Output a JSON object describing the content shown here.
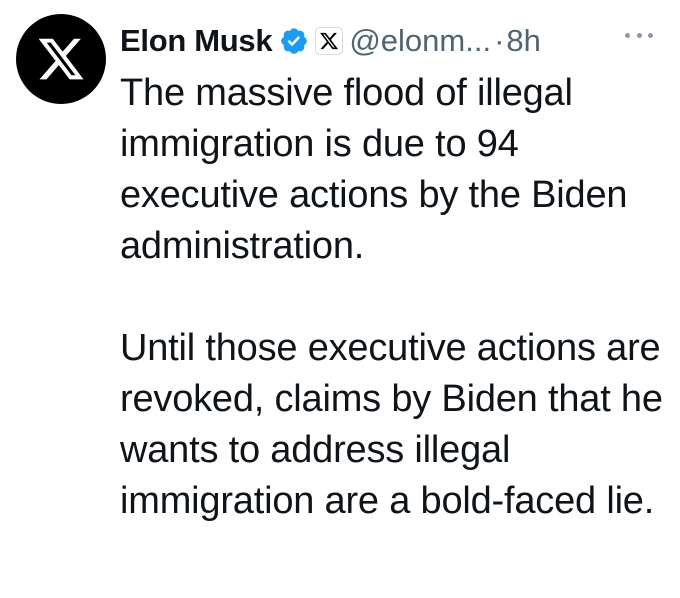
{
  "tweet": {
    "author": {
      "name": "Elon Musk",
      "handle": "@elonm...",
      "avatar_icon": "x-logo-icon",
      "verified_icon": "verified-badge-icon",
      "affiliation_icon": "x-logo-icon"
    },
    "separator": "·",
    "time": "8h",
    "more_icon": "more-options-icon",
    "body": {
      "paragraph_1": "The massive flood of illegal immigration is due to 94 executive actions by the Biden administration.",
      "paragraph_2": "Until those executive actions are revoked, claims by Biden that he wants to address illegal immigration are a bold-faced lie."
    }
  },
  "colors": {
    "text_primary": "#0f1419",
    "text_secondary": "#536471",
    "verified_blue": "#1d9bf0",
    "avatar_bg": "#000000"
  }
}
